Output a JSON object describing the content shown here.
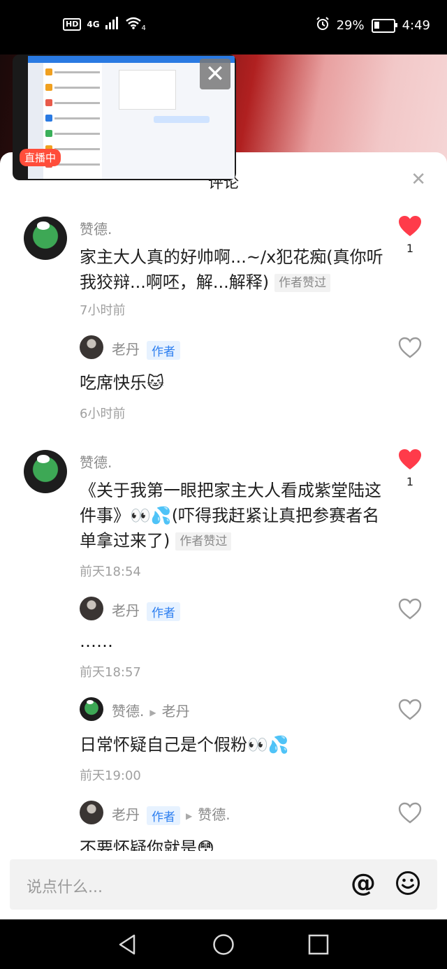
{
  "status_bar": {
    "hd": "HD",
    "network": "4G",
    "wifi": "4",
    "battery": "29%",
    "time": "4:49"
  },
  "live": {
    "badge": "直播中"
  },
  "sheet": {
    "title": "评论"
  },
  "comments": [
    {
      "author": "赞德.",
      "text": "家主大人真的好帅啊...~/x犯花痴(真你听我狡辩...啊呸，解...解释)",
      "liked_tag": "作者赞过",
      "time": "7小时前",
      "likes": "1"
    },
    {
      "author": "老丹",
      "author_tag": "作者",
      "text": "吃席快乐🐱",
      "time": "6小时前"
    },
    {
      "author": "赞德.",
      "text": "《关于我第一眼把家主大人看成紫堂陆这件事》👀💦(吓得我赶紧让真把参赛者名单拿过来了)",
      "liked_tag": "作者赞过",
      "time": "前天18:54",
      "likes": "1"
    },
    {
      "author": "老丹",
      "author_tag": "作者",
      "text": "……",
      "time": "前天18:57"
    },
    {
      "author": "赞德.",
      "reply_to": "老丹",
      "text": "日常怀疑自己是个假粉👀💦",
      "time": "前天19:00"
    },
    {
      "author": "老丹",
      "author_tag": "作者",
      "reply_to": "赞德.",
      "text": "不要怀疑你就是😳"
    }
  ],
  "input": {
    "placeholder": "说点什么..."
  },
  "colors": {
    "heart_active": "#ff3b4a",
    "author_tag_bg": "#e7f2ff",
    "author_tag_text": "#2d7ff0",
    "live_badge": "#ff4d3a"
  },
  "icons": {
    "at": "@",
    "emoji_button": "smile-icon"
  }
}
